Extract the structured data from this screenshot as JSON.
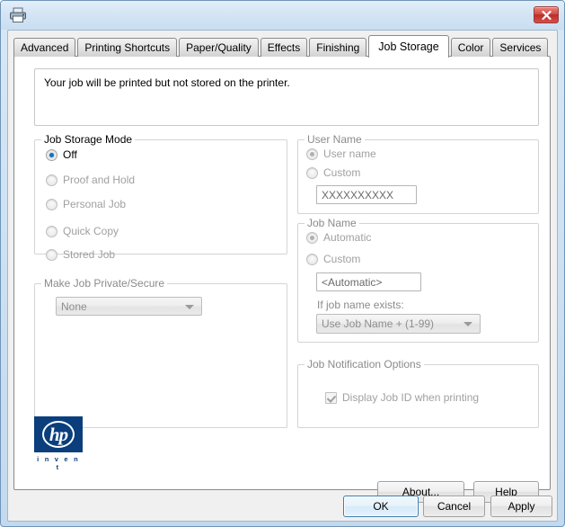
{
  "window": {
    "icon": "printer-icon",
    "close_label": "X"
  },
  "tabs": [
    {
      "label": "Advanced",
      "active": false
    },
    {
      "label": "Printing Shortcuts",
      "active": false
    },
    {
      "label": "Paper/Quality",
      "active": false
    },
    {
      "label": "Effects",
      "active": false
    },
    {
      "label": "Finishing",
      "active": false
    },
    {
      "label": "Job Storage",
      "active": true
    },
    {
      "label": "Color",
      "active": false
    },
    {
      "label": "Services",
      "active": false
    }
  ],
  "status": {
    "message": "Your job will be printed but not stored on the printer."
  },
  "job_storage_mode": {
    "legend": "Job Storage Mode",
    "options": [
      {
        "label": "Off",
        "selected": true,
        "enabled": true
      },
      {
        "label": "Proof and Hold",
        "selected": false,
        "enabled": false
      },
      {
        "label": "Personal Job",
        "selected": false,
        "enabled": false
      },
      {
        "label": "Quick Copy",
        "selected": false,
        "enabled": false
      },
      {
        "label": "Stored Job",
        "selected": false,
        "enabled": false
      }
    ]
  },
  "make_private": {
    "legend": "Make Job Private/Secure",
    "dropdown_value": "None"
  },
  "user_name": {
    "legend": "User Name",
    "options": [
      {
        "label": "User name",
        "selected": true
      },
      {
        "label": "Custom",
        "selected": false
      }
    ],
    "custom_value": "XXXXXXXXXX"
  },
  "job_name": {
    "legend": "Job Name",
    "options": [
      {
        "label": "Automatic",
        "selected": true
      },
      {
        "label": "Custom",
        "selected": false
      }
    ],
    "custom_value": "<Automatic>",
    "exists_label": "If job name exists:",
    "exists_value": "Use Job Name + (1-99)"
  },
  "job_notification": {
    "legend": "Job Notification Options",
    "checkbox_label": "Display Job ID when printing",
    "checked": true
  },
  "logo": {
    "letters": "hp",
    "tagline": "i n v e n t"
  },
  "buttons": {
    "about": "About...",
    "help": "Help",
    "ok": "OK",
    "cancel": "Cancel",
    "apply": "Apply"
  },
  "colors": {
    "accent": "#1f6fb2",
    "hp_blue": "#0a3e7c",
    "close_red": "#bb2b28"
  }
}
